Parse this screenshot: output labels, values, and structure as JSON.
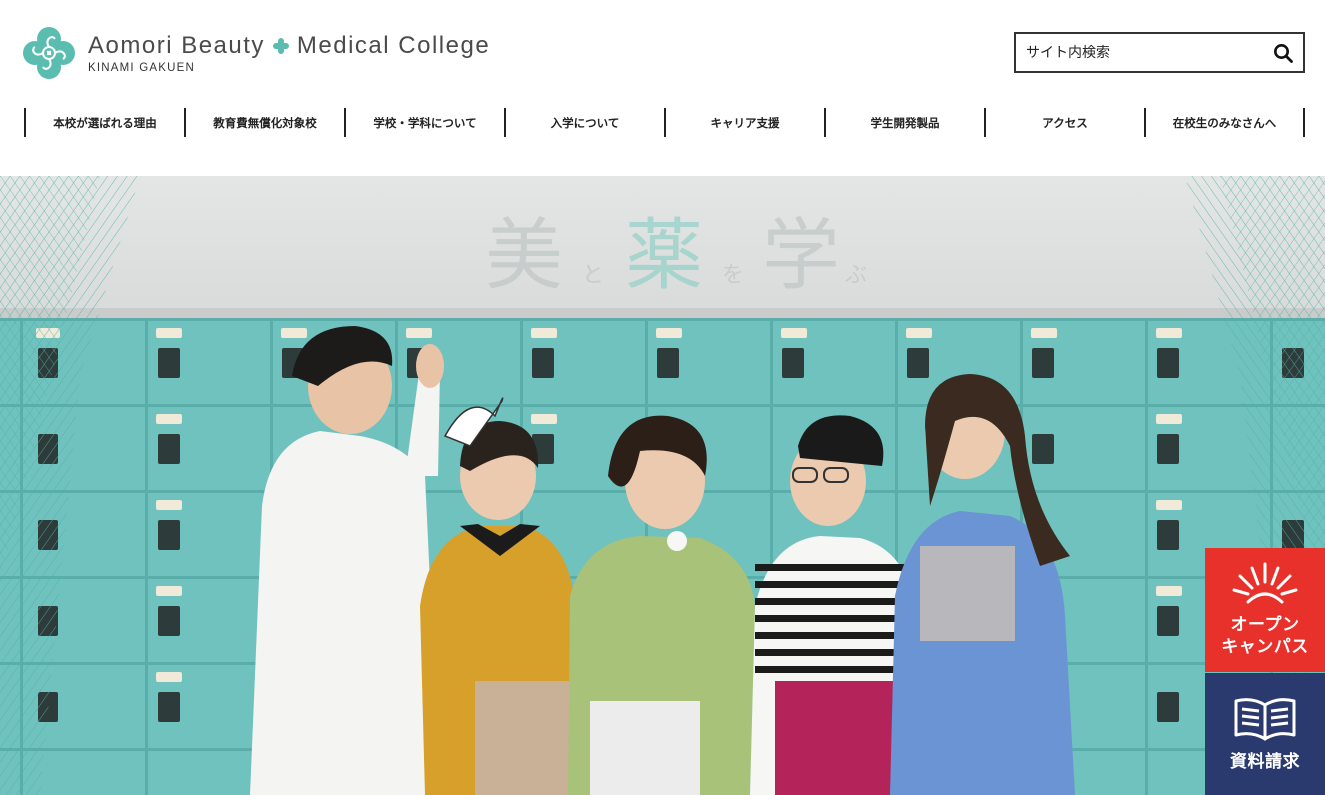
{
  "logo": {
    "title_left": "Aomori Beauty",
    "title_right": "Medical College",
    "subtitle": "KINAMI GAKUEN",
    "brand_color": "#5bbdb0"
  },
  "search": {
    "placeholder": "サイト内検索",
    "icon": "search-icon"
  },
  "nav": {
    "items": [
      {
        "label": "本校が選ばれる理由"
      },
      {
        "label": "教育費無償化対象校"
      },
      {
        "label": "学校・学科について"
      },
      {
        "label": "入学について"
      },
      {
        "label": "キャリア支援"
      },
      {
        "label": "学生開発製品"
      },
      {
        "label": "アクセス"
      },
      {
        "label": "在校生のみなさんへ"
      }
    ]
  },
  "hero": {
    "heading": {
      "c1": "美",
      "p1": "と",
      "c2": "薬",
      "p2": "を",
      "c3": "学",
      "p3": "ぶ"
    },
    "locker_color": "#6fc2be"
  },
  "floating": {
    "open_campus": {
      "line1": "オープン",
      "line2": "キャンパス",
      "color": "#e8312a",
      "icon": "sunburst-icon"
    },
    "brochure": {
      "label": "資料請求",
      "color": "#2a3a6e",
      "icon": "open-book-icon"
    }
  }
}
